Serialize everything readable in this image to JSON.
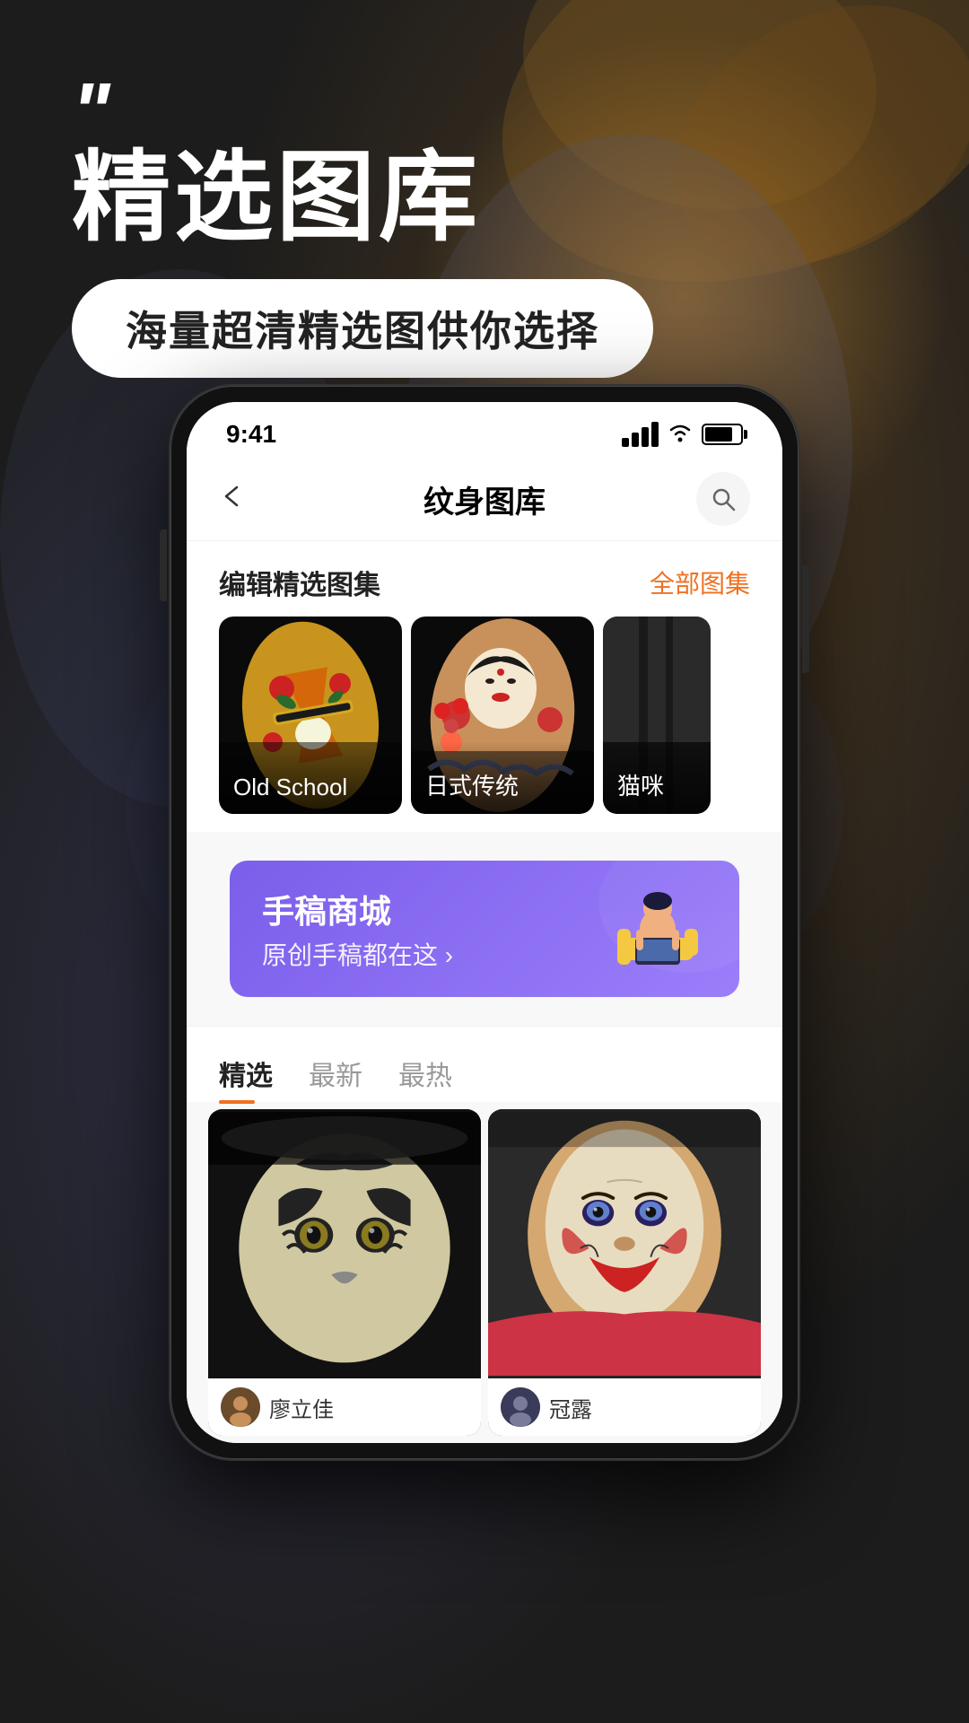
{
  "background": {
    "description": "Dark tattoo art background with demon figure"
  },
  "header": {
    "quote_marks": "\"",
    "main_title": "精选图库",
    "subtitle": "海量超清精选图供你选择"
  },
  "status_bar": {
    "time": "9:41",
    "signal": "signal",
    "wifi": "wifi",
    "battery": "battery"
  },
  "nav": {
    "title": "纹身图库",
    "back_label": "‹",
    "search_label": "🔍"
  },
  "gallery_section": {
    "title": "编辑精选图集",
    "link": "全部图集",
    "cards": [
      {
        "label": "Old School"
      },
      {
        "label": "日式传统"
      },
      {
        "label": "猫咪"
      }
    ]
  },
  "promo_banner": {
    "title": "手稿商城",
    "subtitle": "原创手稿都在这 ›"
  },
  "tabs": [
    {
      "label": "精选",
      "active": true
    },
    {
      "label": "最新",
      "active": false
    },
    {
      "label": "最热",
      "active": false
    }
  ],
  "image_grid": [
    {
      "user_name": "廖立佳"
    },
    {
      "user_name": "冠露"
    }
  ]
}
